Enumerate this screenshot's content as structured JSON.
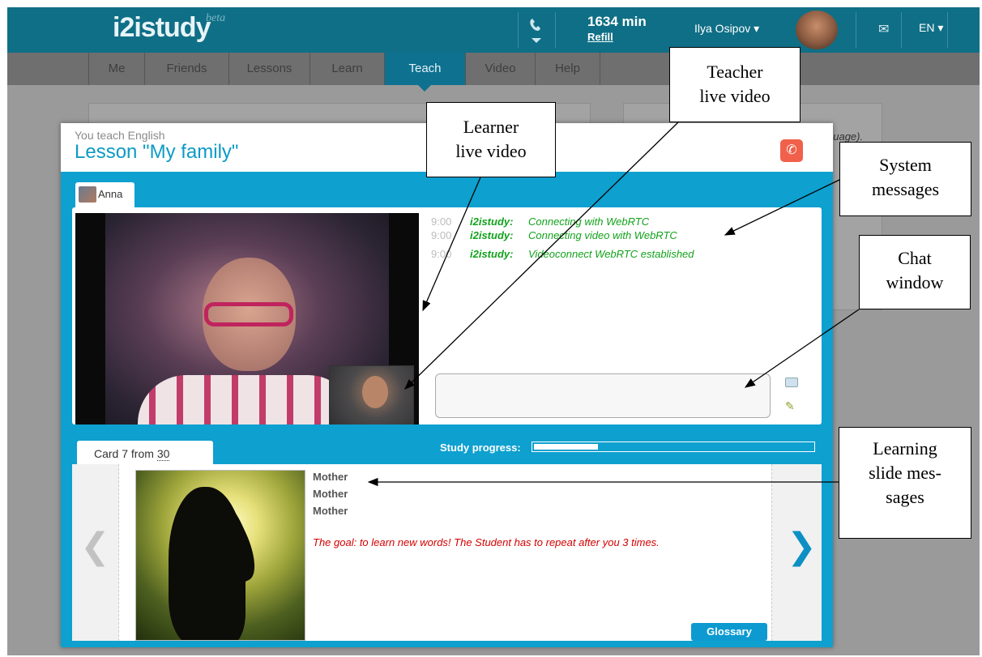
{
  "header": {
    "logo": "i2istudy",
    "logo_badge": "beta",
    "minutes": "1634 min",
    "refill": "Refill",
    "user_name": "Ilya Osipov ▾",
    "language": "EN ▾"
  },
  "nav": {
    "tabs": [
      {
        "label": "Me"
      },
      {
        "label": "Friends"
      },
      {
        "label": "Lessons"
      },
      {
        "label": "Learn"
      },
      {
        "label": "Teach"
      },
      {
        "label": "Video"
      },
      {
        "label": "Help"
      }
    ],
    "active": "Teach"
  },
  "background": {
    "partial_text": "guage)."
  },
  "lesson": {
    "subtitle": "You teach English",
    "title": "Lesson \"My family\"",
    "student_tab": "Anna"
  },
  "chat": {
    "messages": [
      {
        "time": "9:00",
        "sender": "i2istudy:",
        "text": "Connecting with WebRTC"
      },
      {
        "time": "9:00",
        "sender": "i2istudy:",
        "text": "Connecting video with WebRTC"
      },
      {
        "time": "9:00",
        "sender": "i2istudy:",
        "text": "Videoconnect WebRTC established"
      }
    ],
    "input_value": ""
  },
  "card": {
    "tab_prefix": "Card 7 from",
    "total": "30",
    "progress_label": "Study progress:",
    "progress_fraction": 0.23,
    "words": [
      "Mother",
      "Mother",
      "Mother"
    ],
    "goal": "The goal: to learn new words! The Student has to repeat after you 3 times.",
    "glossary_button": "Glossary",
    "prev_arrow": "❮",
    "next_arrow": "❯"
  },
  "callouts": {
    "learner_video": [
      "Learner",
      "live video"
    ],
    "teacher_video": [
      "Teacher",
      "live video"
    ],
    "system_messages": [
      "System",
      "messages"
    ],
    "chat_window": [
      "Chat",
      "window"
    ],
    "learning_slide": [
      "Learning",
      "slide mes-",
      "sages"
    ]
  },
  "colors": {
    "header_bg": "#0f6f86",
    "accent": "#0ea0cf",
    "system_message": "#12a21b",
    "goal_text": "#d40000",
    "hangup": "#f0604a"
  },
  "icons": [
    "phone-icon",
    "mail-icon",
    "hangup-icon",
    "smiley-icon",
    "pencil-icon",
    "prev-arrow-icon",
    "next-arrow-icon"
  ]
}
